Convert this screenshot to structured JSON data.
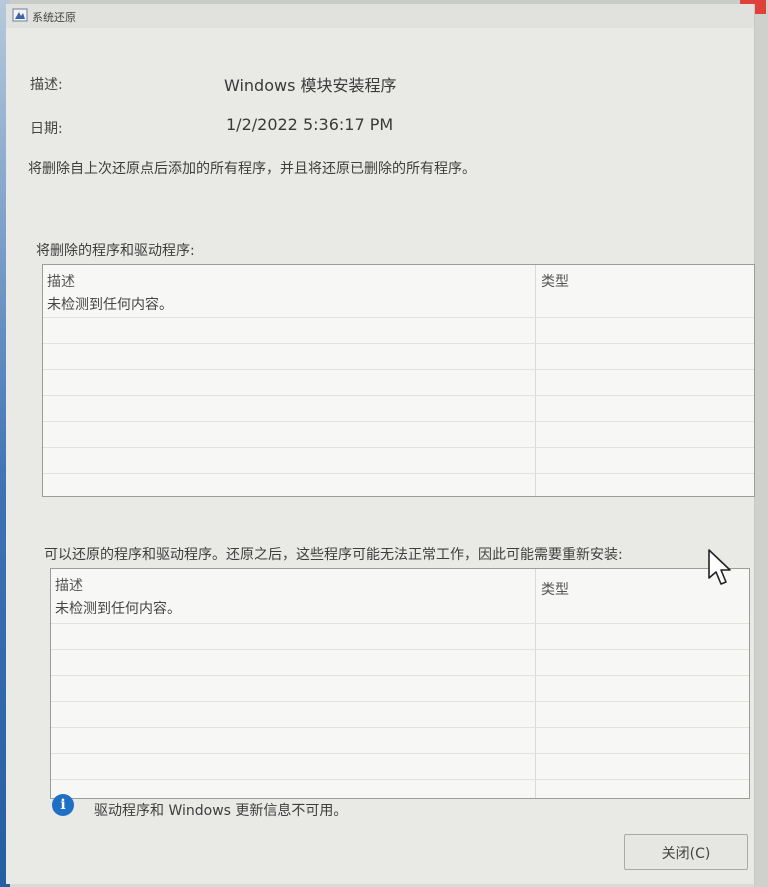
{
  "window": {
    "title": "系统还原"
  },
  "details": {
    "description_label": "描述:",
    "description_value": "Windows 模块安装程序",
    "date_label": "日期:",
    "date_value": "1/2/2022 5:36:17 PM",
    "summary": "将删除自上次还原点后添加的所有程序，并且将还原已删除的所有程序。"
  },
  "deleted_section": {
    "label": "将删除的程序和驱动程序:",
    "columns": [
      "描述",
      "类型"
    ],
    "empty_text": "未检测到任何内容。"
  },
  "restored_section": {
    "label": "可以还原的程序和驱动程序。还原之后，这些程序可能无法正常工作，因此可能需要重新安装:",
    "columns": [
      "描述",
      "类型"
    ],
    "empty_text": "未检测到任何内容。"
  },
  "info": {
    "icon": "info-icon",
    "text": "驱动程序和 Windows 更新信息不可用。"
  },
  "buttons": {
    "close": "关闭(C)"
  }
}
